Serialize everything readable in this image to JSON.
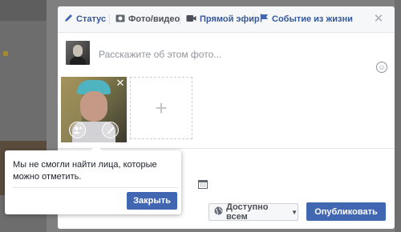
{
  "tabs": {
    "status": "Статус",
    "photo_video": "Фото/видео",
    "live": "Прямой эфир",
    "life_event": "Событие из жизни"
  },
  "composer": {
    "placeholder": "Расскажите об этом фото..."
  },
  "bottom": {
    "audience": "Доступно всем",
    "publish": "Опубликовать"
  },
  "tooltip": {
    "message": "Мы не смогли найти лица, которые можно отметить.",
    "close": "Закрыть"
  },
  "icons": {
    "status": "pencil-icon",
    "photo": "camera-icon",
    "live": "video-camera-icon",
    "life_event": "flag-icon",
    "close": "close-icon",
    "emoji": "smiley-icon",
    "add": "plus-icon",
    "tag": "tag-person-icon",
    "edit": "brush-icon",
    "calendar": "calendar-icon",
    "audience": "globe-icon"
  },
  "colors": {
    "brand": "#4267b2",
    "link": "#365899",
    "overlay": "#7f7f7f"
  }
}
